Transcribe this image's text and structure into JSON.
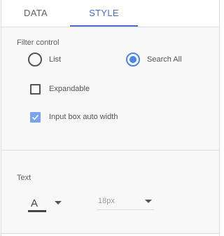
{
  "tabs": [
    {
      "label": "DATA",
      "active": false
    },
    {
      "label": "STYLE",
      "active": true
    }
  ],
  "colors": {
    "accent": "#4a6dc6",
    "radio_checked": "#4a86e8",
    "checkbox_checked": "#7ba2ee"
  },
  "filter_control": {
    "title": "Filter control",
    "options": [
      {
        "label": "List",
        "selected": false
      },
      {
        "label": "Search All",
        "selected": true
      }
    ],
    "expandable": {
      "label": "Expandable",
      "checked": false
    },
    "auto_width": {
      "label": "Input box auto width",
      "checked": true
    }
  },
  "text_section": {
    "title": "Text",
    "font_color_glyph": "A",
    "font_size": "18px"
  }
}
